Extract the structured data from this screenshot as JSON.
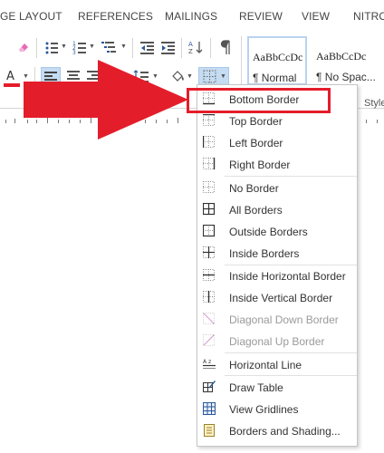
{
  "tabs": [
    "GE LAYOUT",
    "REFERENCES",
    "MAILINGS",
    "REVIEW",
    "VIEW",
    "NITRO"
  ],
  "styles": {
    "items": [
      {
        "sample": "AaBbCcDc",
        "name": "¶ Normal"
      },
      {
        "sample": "AaBbCcDc",
        "name": "¶ No Spac..."
      }
    ],
    "group_label": "Style"
  },
  "menu": {
    "items": [
      {
        "label": "Bottom Border",
        "icon": "bottom-border-icon"
      },
      {
        "label": "Top Border",
        "icon": "top-border-icon"
      },
      {
        "label": "Left Border",
        "icon": "left-border-icon"
      },
      {
        "label": "Right Border",
        "icon": "right-border-icon"
      },
      {
        "label": "No Border",
        "icon": "no-border-icon"
      },
      {
        "label": "All Borders",
        "icon": "all-borders-icon"
      },
      {
        "label": "Outside Borders",
        "icon": "outside-borders-icon"
      },
      {
        "label": "Inside Borders",
        "icon": "inside-borders-icon"
      },
      {
        "label": "Inside Horizontal Border",
        "icon": "inside-horizontal-border-icon"
      },
      {
        "label": "Inside Vertical Border",
        "icon": "inside-vertical-border-icon"
      },
      {
        "label": "Diagonal Down Border",
        "icon": "diagonal-down-border-icon",
        "disabled": true
      },
      {
        "label": "Diagonal Up Border",
        "icon": "diagonal-up-border-icon",
        "disabled": true
      },
      {
        "label": "Horizontal Line",
        "icon": "horizontal-line-icon"
      },
      {
        "label": "Draw Table",
        "icon": "draw-table-icon"
      },
      {
        "label": "View Gridlines",
        "icon": "view-gridlines-icon"
      },
      {
        "label": "Borders and Shading...",
        "icon": "borders-shading-icon"
      }
    ]
  },
  "colors": {
    "arrow": "#e41d2b",
    "highlight": "#e41d2b",
    "font_color_bar": "#e41d2b",
    "selected_align": "#c5dcf2"
  }
}
